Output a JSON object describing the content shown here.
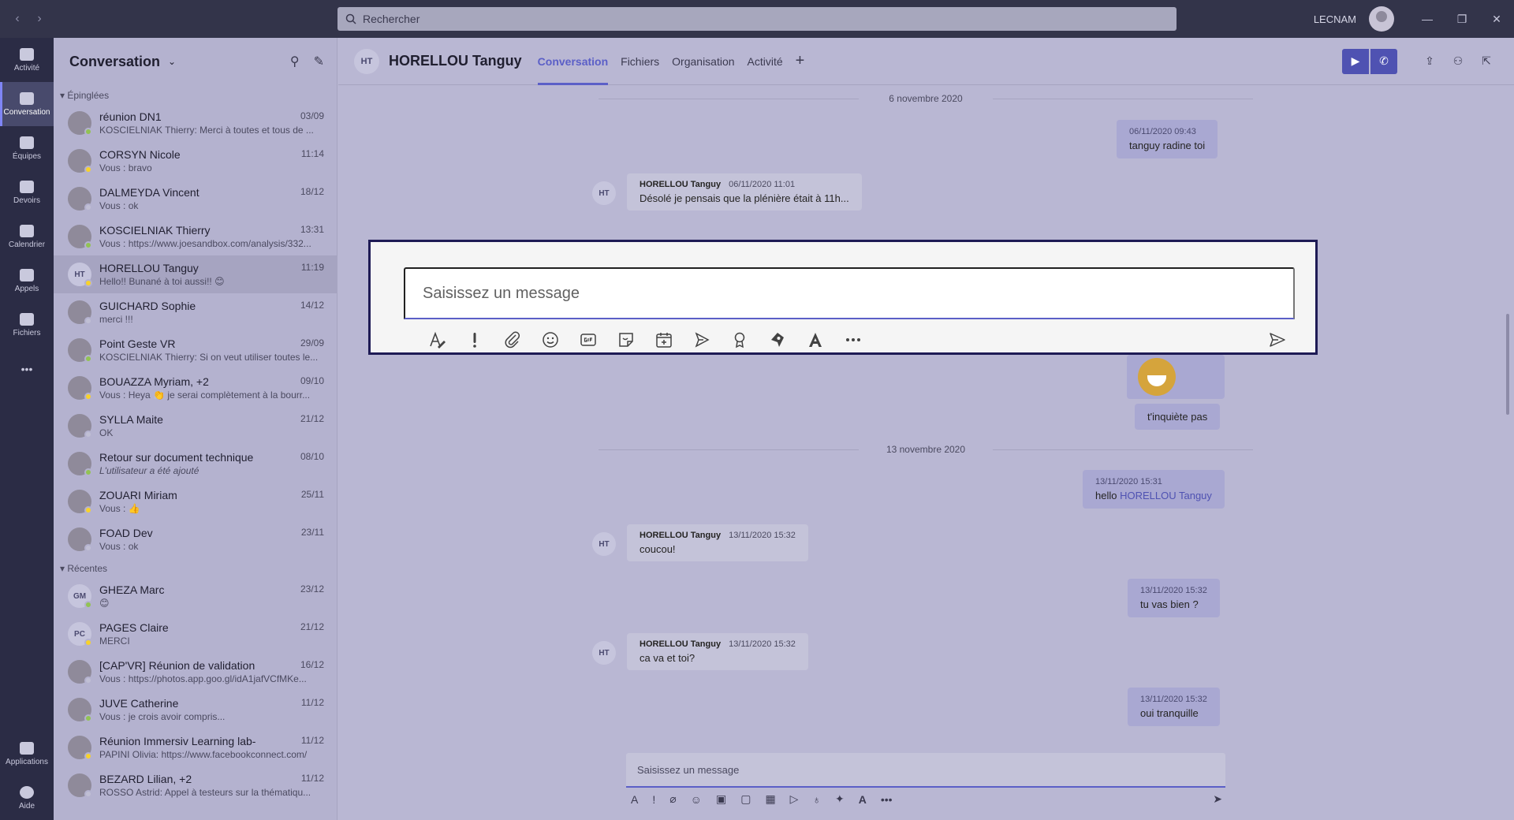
{
  "topbar": {
    "search_placeholder": "Rechercher",
    "org_label": "LECNAM"
  },
  "rail": {
    "items": [
      {
        "label": "Activité",
        "icon": "bell-icon"
      },
      {
        "label": "Conversation",
        "icon": "chat-icon"
      },
      {
        "label": "Équipes",
        "icon": "teams-icon"
      },
      {
        "label": "Devoirs",
        "icon": "assignments-icon"
      },
      {
        "label": "Calendrier",
        "icon": "calendar-icon"
      },
      {
        "label": "Appels",
        "icon": "phone-icon"
      },
      {
        "label": "Fichiers",
        "icon": "files-icon"
      }
    ],
    "more": "•••",
    "bottom": [
      {
        "label": "Applications",
        "icon": "apps-icon"
      },
      {
        "label": "Aide",
        "icon": "help-icon"
      }
    ]
  },
  "list": {
    "title": "Conversation",
    "pinned_label": "Épinglées",
    "recent_label": "Récentes",
    "pinned": [
      {
        "name": "réunion DN1",
        "date": "03/09",
        "preview": "KOSCIELNIAK Thierry: Merci à toutes et tous de ..."
      },
      {
        "name": "CORSYN Nicole",
        "date": "11:14",
        "preview": "Vous : bravo"
      },
      {
        "name": "DALMEYDA Vincent",
        "date": "18/12",
        "preview": "Vous : ok"
      },
      {
        "name": "KOSCIELNIAK Thierry",
        "date": "13:31",
        "preview": "Vous : https://www.joesandbox.com/analysis/332..."
      },
      {
        "name": "HORELLOU Tanguy",
        "date": "11:19",
        "preview": "Hello!! Bunané à toi aussi!! 😊",
        "initials": "HT"
      },
      {
        "name": "GUICHARD Sophie",
        "date": "14/12",
        "preview": "merci !!!"
      },
      {
        "name": "Point Geste VR",
        "date": "29/09",
        "preview": "KOSCIELNIAK Thierry: Si on veut utiliser toutes le..."
      },
      {
        "name": "BOUAZZA Myriam, +2",
        "date": "09/10",
        "preview": "Vous : Heya 👏 je serai complètement à la bourr..."
      },
      {
        "name": "SYLLA Maite",
        "date": "21/12",
        "preview": "OK"
      },
      {
        "name": "Retour sur document technique",
        "date": "08/10",
        "preview": "L'utilisateur a été ajouté"
      },
      {
        "name": "ZOUARI Miriam",
        "date": "25/11",
        "preview": "Vous : 👍"
      },
      {
        "name": "FOAD Dev",
        "date": "23/11",
        "preview": "Vous : ok"
      }
    ],
    "recent": [
      {
        "name": "GHEZA Marc",
        "date": "23/12",
        "preview": "😊",
        "initials": "GM"
      },
      {
        "name": "PAGES Claire",
        "date": "21/12",
        "preview": "MERCI",
        "initials": "PC"
      },
      {
        "name": "[CAP'VR] Réunion de validation",
        "date": "16/12",
        "preview": "Vous : https://photos.app.goo.gl/idA1jafVCfMKe..."
      },
      {
        "name": "JUVE Catherine",
        "date": "11/12",
        "preview": "Vous : je crois avoir compris..."
      },
      {
        "name": "Réunion Immersiv Learning lab-",
        "date": "11/12",
        "preview": "PAPINI Olivia: https://www.facebookconnect.com/"
      },
      {
        "name": "BEZARD Lilian, +2",
        "date": "11/12",
        "preview": "ROSSO Astrid: Appel à testeurs sur la thématiqu..."
      }
    ]
  },
  "chat": {
    "initials": "HT",
    "name": "HORELLOU Tanguy",
    "tabs": [
      "Conversation",
      "Fichiers",
      "Organisation",
      "Activité"
    ],
    "date1": "6 novembre 2020",
    "date2": "13 novembre 2020",
    "m1_meta": "06/11/2020 09:43",
    "m1_text": "tanguy radine toi",
    "m2_author": "HORELLOU Tanguy",
    "m2_meta": "06/11/2020 11:01",
    "m2_text": "Désolé je pensais que la plénière était à 11h...",
    "m3_text": "t'inquiète pas",
    "m4_meta": "13/11/2020 15:31",
    "m4_text": "hello",
    "m4_mention": "HORELLOU Tanguy",
    "m5_author": "HORELLOU Tanguy",
    "m5_meta": "13/11/2020 15:32",
    "m5_text": "coucou!",
    "m6_meta": "13/11/2020 15:32",
    "m6_text": "tu vas bien ?",
    "m7_author": "HORELLOU Tanguy",
    "m7_meta": "13/11/2020 15:32",
    "m7_text": "ca va et toi?",
    "m8_meta": "13/11/2020 15:32",
    "m8_text": "oui tranquille",
    "compose_placeholder": "Saisissez un message"
  },
  "compose_focus": {
    "placeholder": "Saisissez un message",
    "tools": [
      "format-icon",
      "important-icon",
      "attach-icon",
      "emoji-icon",
      "gif-icon",
      "sticker-icon",
      "meeting-icon",
      "stream-icon",
      "praise-icon",
      "loop-icon",
      "text-style-icon",
      "more-options-icon"
    ]
  }
}
